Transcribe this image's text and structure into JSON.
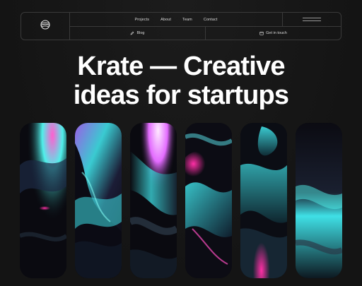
{
  "header": {
    "nav": [
      {
        "label": "Projects"
      },
      {
        "label": "About"
      },
      {
        "label": "Team"
      },
      {
        "label": "Contact"
      }
    ],
    "blog_label": "Blog",
    "cta_label": "Get in touch",
    "logo_icon": "globe-logo-icon",
    "menu_icon": "hamburger-menu-icon"
  },
  "hero": {
    "line1": "Krate — Creative",
    "line2": "ideas for startups"
  },
  "gallery": {
    "accent_cyan": "#3fe0e6",
    "accent_magenta": "#ff2fa6",
    "panels": [
      {
        "name": "abstract-panel-1"
      },
      {
        "name": "abstract-panel-2"
      },
      {
        "name": "abstract-panel-3"
      },
      {
        "name": "abstract-panel-4"
      },
      {
        "name": "abstract-panel-5"
      },
      {
        "name": "abstract-panel-6"
      }
    ]
  }
}
